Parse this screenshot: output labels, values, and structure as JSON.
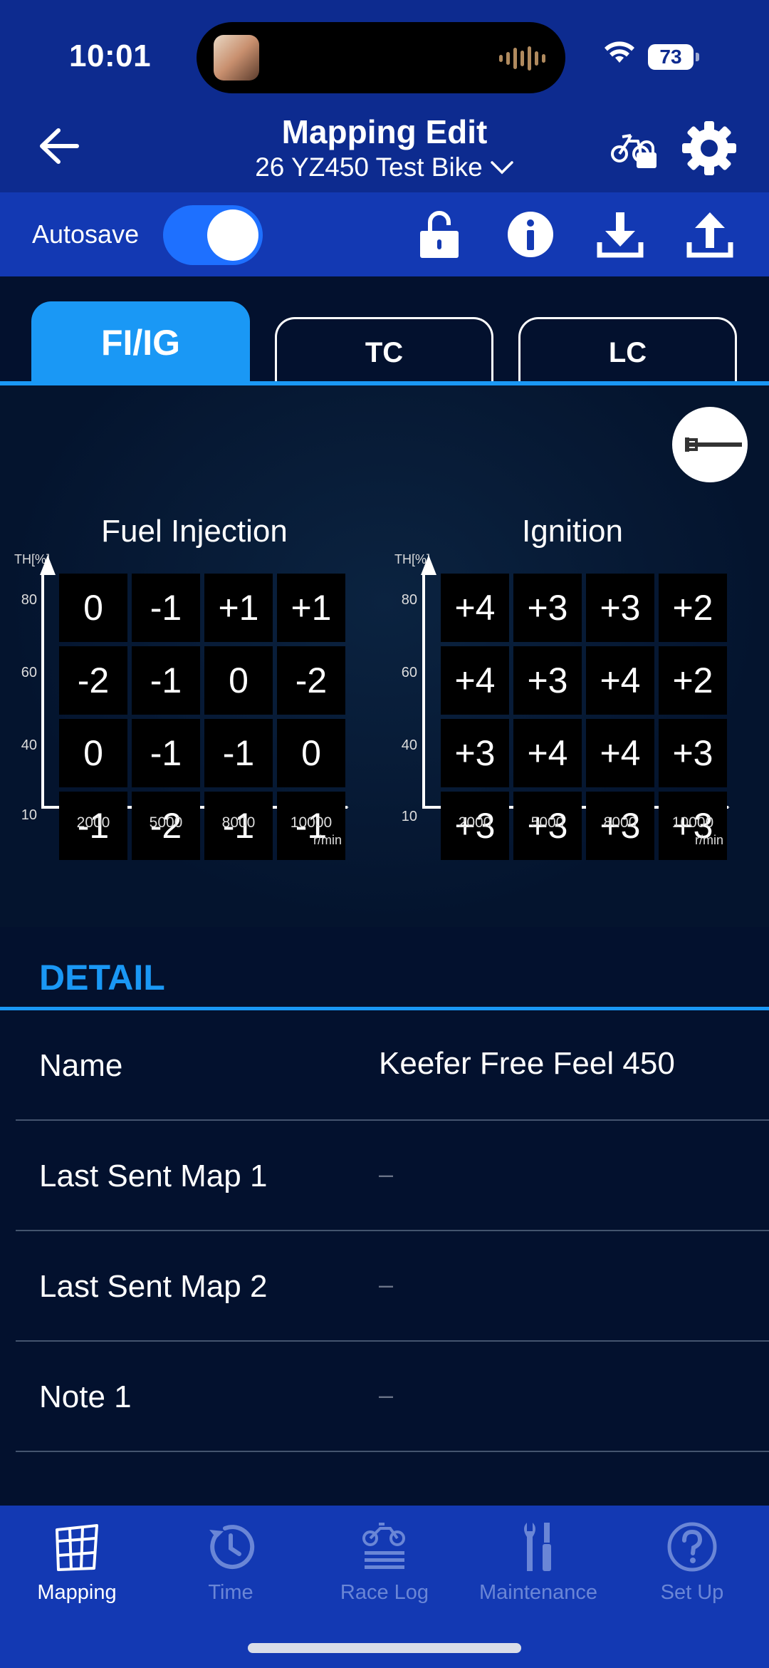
{
  "status_bar": {
    "time": "10:01",
    "battery": "73"
  },
  "header": {
    "title": "Mapping Edit",
    "subtitle": "26 YZ450 Test Bike"
  },
  "toolbar": {
    "autosave_label": "Autosave",
    "autosave_on": true
  },
  "tabs": [
    {
      "label": "FI/IG",
      "active": true
    },
    {
      "label": "TC",
      "active": false
    },
    {
      "label": "LC",
      "active": false
    }
  ],
  "fuel_map": {
    "title": "Fuel Injection",
    "y_axis_label": "TH[%]",
    "x_unit": "r/min",
    "y_ticks": [
      "80",
      "60",
      "40",
      "10"
    ],
    "x_ticks": [
      "2000",
      "5000",
      "8000",
      "10000"
    ],
    "rows": [
      [
        "0",
        "-1",
        "+1",
        "+1"
      ],
      [
        "-2",
        "-1",
        "0",
        "-2"
      ],
      [
        "0",
        "-1",
        "-1",
        "0"
      ],
      [
        "-1",
        "-2",
        "-1",
        "-1"
      ]
    ]
  },
  "ignition_map": {
    "title": "Ignition",
    "y_axis_label": "TH[%]",
    "x_unit": "r/min",
    "y_ticks": [
      "80",
      "60",
      "40",
      "10"
    ],
    "x_ticks": [
      "2000",
      "5000",
      "8000",
      "10000"
    ],
    "rows": [
      [
        "+4",
        "+3",
        "+3",
        "+2"
      ],
      [
        "+4",
        "+3",
        "+4",
        "+2"
      ],
      [
        "+3",
        "+4",
        "+4",
        "+3"
      ],
      [
        "+3",
        "+3",
        "+3",
        "+3"
      ]
    ]
  },
  "detail": {
    "title": "DETAIL",
    "rows": [
      {
        "label": "Name",
        "value": "Keefer Free Feel 450"
      },
      {
        "label": "Last Sent Map 1",
        "value": "–"
      },
      {
        "label": "Last Sent Map 2",
        "value": "–"
      },
      {
        "label": "Note 1",
        "value": "–"
      }
    ]
  },
  "tabbar": [
    {
      "label": "Mapping",
      "icon": "map-grid-icon",
      "active": true
    },
    {
      "label": "Time",
      "icon": "clock-refresh-icon",
      "active": false
    },
    {
      "label": "Race Log",
      "icon": "bike-log-icon",
      "active": false
    },
    {
      "label": "Maintenance",
      "icon": "tools-icon",
      "active": false
    },
    {
      "label": "Set Up",
      "icon": "help-circle-icon",
      "active": false
    }
  ],
  "colors": {
    "header": "#0d2b8f",
    "toolbar": "#1339b3",
    "accent": "#1a98f5",
    "background": "#03112e"
  }
}
